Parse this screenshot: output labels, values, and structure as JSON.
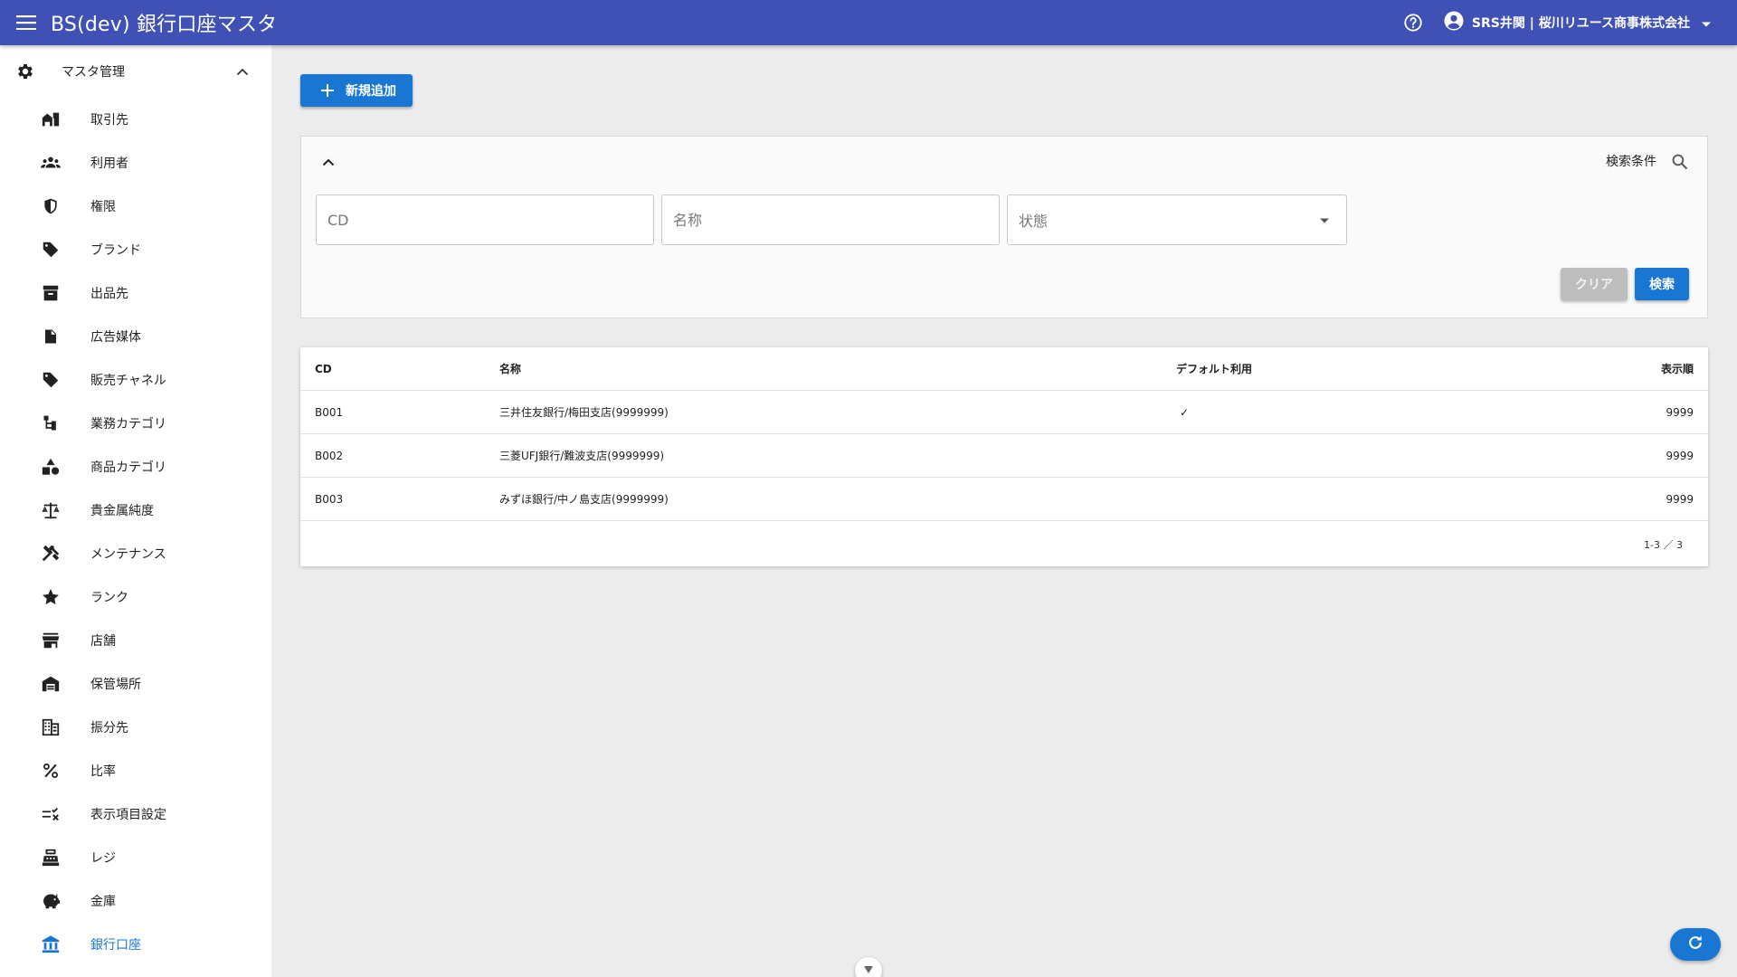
{
  "appbar": {
    "title": "BS(dev) 銀行口座マスタ",
    "user_name": "SRS井関 | 桜川リユース商事株式会社",
    "color": "#3f51b5"
  },
  "sidebar": {
    "group": {
      "label": "マスタ管理",
      "icon": "gear-icon",
      "expanded": true
    },
    "items": [
      {
        "label": "取引先",
        "icon": "storefront-icon"
      },
      {
        "label": "利用者",
        "icon": "group-icon"
      },
      {
        "label": "権限",
        "icon": "shield-icon"
      },
      {
        "label": "ブランド",
        "icon": "tag-icon"
      },
      {
        "label": "出品先",
        "icon": "archive-icon"
      },
      {
        "label": "広告媒体",
        "icon": "document-icon"
      },
      {
        "label": "販売チャネル",
        "icon": "tag-icon"
      },
      {
        "label": "業務カテゴリ",
        "icon": "tree-icon"
      },
      {
        "label": "商品カテゴリ",
        "icon": "shapes-icon"
      },
      {
        "label": "貴金属純度",
        "icon": "scale-icon"
      },
      {
        "label": "メンテナンス",
        "icon": "tools-icon"
      },
      {
        "label": "ランク",
        "icon": "star-icon"
      },
      {
        "label": "店舗",
        "icon": "store-icon"
      },
      {
        "label": "保管場所",
        "icon": "warehouse-icon"
      },
      {
        "label": "振分先",
        "icon": "building-icon"
      },
      {
        "label": "比率",
        "icon": "percent-icon"
      },
      {
        "label": "表示項目設定",
        "icon": "checklist-icon"
      },
      {
        "label": "レジ",
        "icon": "register-icon"
      },
      {
        "label": "金庫",
        "icon": "piggy-bank-icon"
      },
      {
        "label": "銀行口座",
        "icon": "bank-icon",
        "active": true
      }
    ],
    "active_color": "#1976d2"
  },
  "main": {
    "add_button": "新規追加",
    "search": {
      "title": "検索条件",
      "cd_placeholder": "CD",
      "name_placeholder": "名称",
      "state_placeholder": "状態",
      "clear_label": "クリア",
      "search_label": "検索"
    },
    "table": {
      "columns": [
        "CD",
        "名称",
        "デフォルト利用",
        "表示順"
      ],
      "rows": [
        {
          "cd": "B001",
          "name": "三井住友銀行/梅田支店(9999999)",
          "default": "✓",
          "order": "9999"
        },
        {
          "cd": "B002",
          "name": "三菱UFJ銀行/難波支店(9999999)",
          "default": "",
          "order": "9999"
        },
        {
          "cd": "B003",
          "name": "みずほ銀行/中ノ島支店(9999999)",
          "default": "",
          "order": "9999"
        }
      ],
      "pager": "1-3 ／ 3"
    },
    "primary_color": "#1976d2"
  }
}
